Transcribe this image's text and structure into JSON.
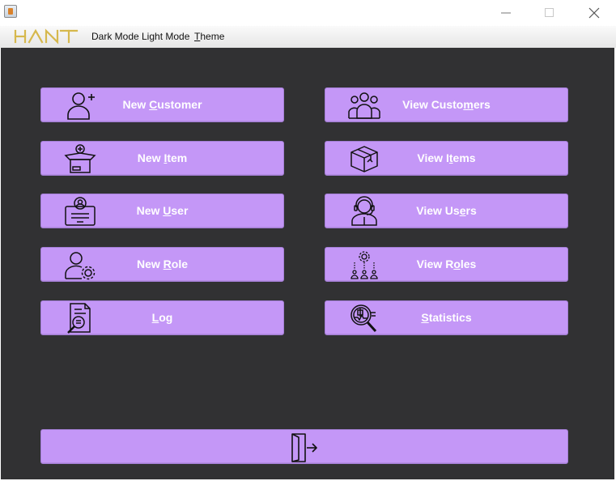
{
  "window": {
    "icon": "java-cup-icon",
    "controls": [
      "minimize-icon",
      "maximize-icon",
      "close-icon"
    ]
  },
  "menubar": {
    "logo_text": "HANT",
    "items": [
      {
        "label": "Dark Mode"
      },
      {
        "label": "Light Mode"
      },
      {
        "label": "Theme",
        "mnemonic": "T"
      }
    ]
  },
  "buttons": [
    {
      "label": "New Customer",
      "mnemonic": "C",
      "icon": "add-user-icon"
    },
    {
      "label": "View Customers",
      "mnemonic": "m",
      "icon": "users-group-icon"
    },
    {
      "label": "New Item",
      "mnemonic": "I",
      "icon": "add-box-icon"
    },
    {
      "label": "View Items",
      "mnemonic": "t",
      "icon": "package-icon"
    },
    {
      "label": "New User",
      "mnemonic": "U",
      "icon": "id-card-icon"
    },
    {
      "label": "View Users",
      "mnemonic": "e",
      "icon": "support-agent-icon"
    },
    {
      "label": "New Role",
      "mnemonic": "R",
      "icon": "user-settings-icon"
    },
    {
      "label": "View Roles",
      "mnemonic": "o",
      "icon": "roles-hierarchy-icon"
    },
    {
      "label": "Log",
      "mnemonic": "L",
      "icon": "document-search-icon"
    },
    {
      "label": "Statistics",
      "mnemonic": "S",
      "icon": "analytics-search-icon"
    }
  ],
  "exit": {
    "icon": "exit-door-icon"
  },
  "colors": {
    "background": "#313133",
    "button": "#c497f7",
    "button_text": "#ffffff",
    "logo_gold": "#d6b84d"
  }
}
